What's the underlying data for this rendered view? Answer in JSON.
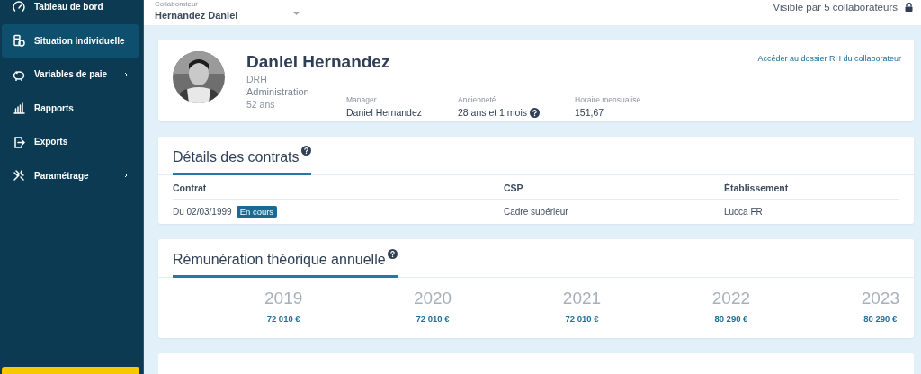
{
  "sidebar": {
    "items": [
      {
        "label": "Tableau de bord",
        "kind": "gauge",
        "selected": false,
        "submenu": false
      },
      {
        "label": "Situation individuelle",
        "kind": "coins",
        "selected": true,
        "submenu": false
      },
      {
        "label": "Variables de paie",
        "kind": "piggy",
        "selected": false,
        "submenu": true
      },
      {
        "label": "Rapports",
        "kind": "chart",
        "selected": false,
        "submenu": false
      },
      {
        "label": "Exports",
        "kind": "export",
        "selected": false,
        "submenu": false
      },
      {
        "label": "Paramétrage",
        "kind": "tools",
        "selected": false,
        "submenu": true
      }
    ]
  },
  "collaborator_field": {
    "label": "Collaborateur",
    "value": "Hernandez Daniel"
  },
  "visibility": {
    "text": "Visible par 5 collaborateurs"
  },
  "profile": {
    "name": "Daniel Hernandez",
    "role": "DRH",
    "department": "Administration",
    "age": "52 ans",
    "link": "Accéder au dossier RH du collaborateur",
    "facts": [
      {
        "label": "Manager",
        "value": "Daniel Hernandez",
        "help": false
      },
      {
        "label": "Ancienneté",
        "value": "28 ans et 1 mois",
        "help": true
      },
      {
        "label": "Horaire mensualisé",
        "value": "151,67",
        "help": false
      }
    ]
  },
  "contracts": {
    "title": "Détails des contrats",
    "columns": [
      "Contrat",
      "CSP",
      "Établissement"
    ],
    "rows": [
      {
        "start": "Du 02/03/1999",
        "badge": "En cours",
        "csp": "Cadre supérieur",
        "establishment": "Lucca FR"
      }
    ]
  },
  "salary": {
    "title": "Rémunération théorique annuelle",
    "years": [
      {
        "year": "2019",
        "amount": "72 010 €"
      },
      {
        "year": "2020",
        "amount": "72 010 €"
      },
      {
        "year": "2021",
        "amount": "72 010 €"
      },
      {
        "year": "2022",
        "amount": "80 290 €"
      },
      {
        "year": "2023",
        "amount": "80 290 €"
      }
    ]
  }
}
